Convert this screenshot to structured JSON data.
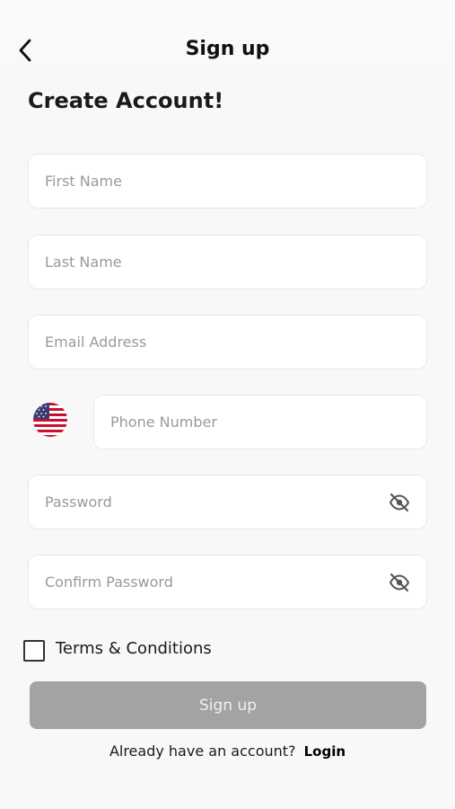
{
  "header": {
    "title": "Sign up"
  },
  "page": {
    "heading": "Create Account!"
  },
  "form": {
    "first_name": {
      "placeholder": "First Name",
      "value": ""
    },
    "last_name": {
      "placeholder": "Last Name",
      "value": ""
    },
    "email": {
      "placeholder": "Email Address",
      "value": ""
    },
    "phone": {
      "placeholder": "Phone Number",
      "value": "",
      "country_flag": "us-flag-icon"
    },
    "password": {
      "placeholder": "Password",
      "value": "",
      "visibility_icon": "eye-off-icon"
    },
    "confirm_password": {
      "placeholder": "Confirm Password",
      "value": "",
      "visibility_icon": "eye-off-icon"
    },
    "terms": {
      "label": "Terms & Conditions",
      "checked": false
    },
    "submit_label": "Sign up"
  },
  "footer": {
    "prompt": "Already have an account?",
    "login_label": "Login"
  },
  "colors": {
    "button_disabled": "#a3a3a3",
    "field_border": "#e8e8ea",
    "background": "#f8f8f8"
  }
}
